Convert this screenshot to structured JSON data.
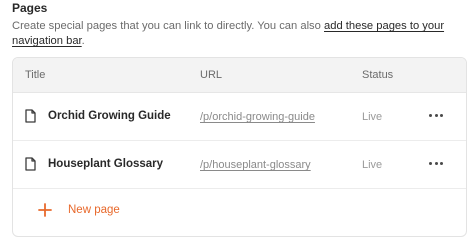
{
  "section": {
    "title": "Pages",
    "description_prefix": "Create special pages that you can link to directly. You can also ",
    "description_link": "add these pages to your navigation bar",
    "description_suffix": "."
  },
  "table": {
    "columns": [
      "Title",
      "URL",
      "Status"
    ],
    "rows": [
      {
        "title": "Orchid Growing Guide",
        "url": "/p/orchid-growing-guide",
        "status": "Live",
        "icon": "document-icon",
        "actions_icon": "more-horizontal-icon"
      },
      {
        "title": "Houseplant Glossary",
        "url": "/p/houseplant-glossary",
        "status": "Live",
        "icon": "document-icon",
        "actions_icon": "more-horizontal-icon"
      }
    ]
  },
  "new_page": {
    "label": "New page",
    "icon": "plus-icon"
  },
  "colors": {
    "accent": "#e8692c",
    "header_bg": "#f3f3f3",
    "border": "#e3e3e3"
  }
}
